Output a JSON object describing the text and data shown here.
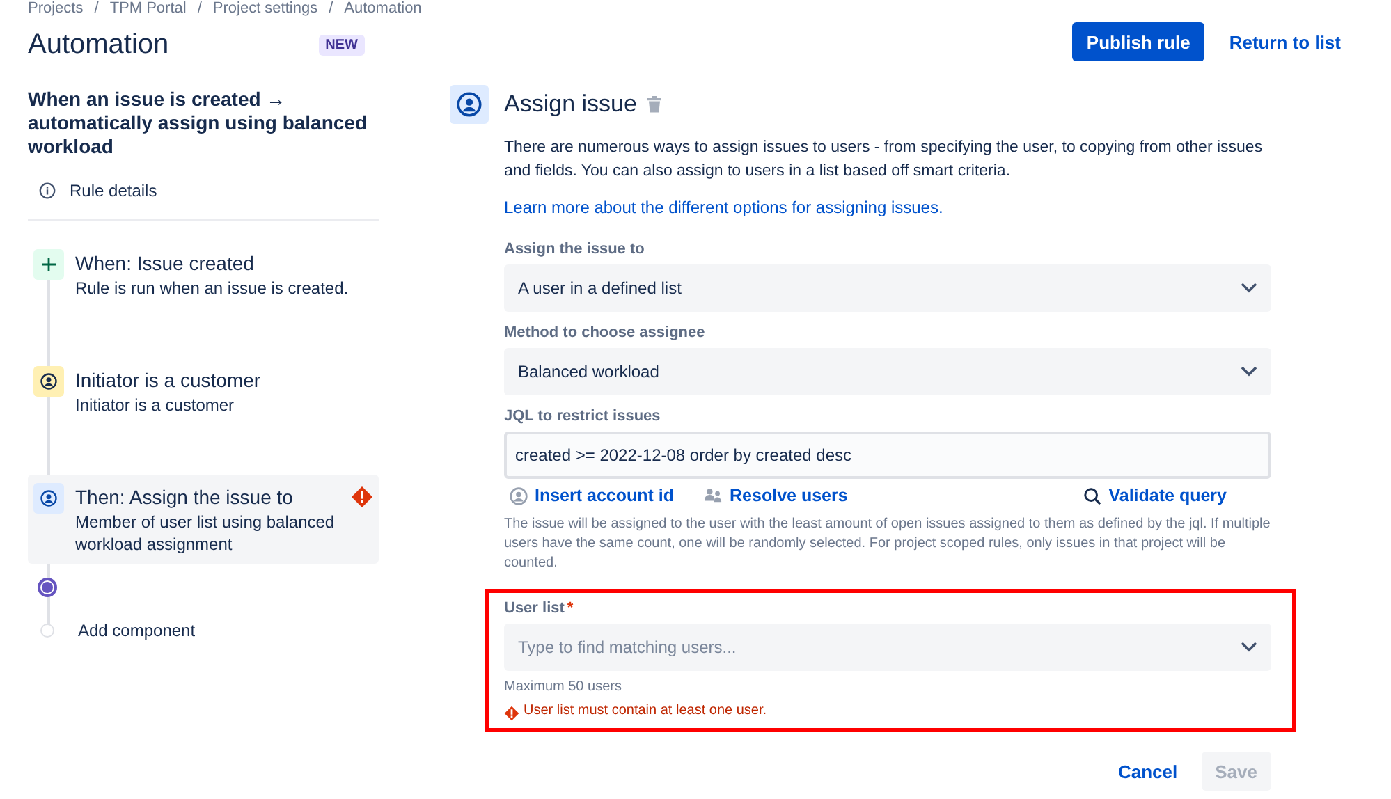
{
  "breadcrumbs": {
    "separator": "/",
    "items": [
      "Projects",
      "TPM Portal",
      "Project settings",
      "Automation"
    ]
  },
  "sidebar": {
    "title": "Automation",
    "badge": "NEW",
    "rule_name": "When an issue is created → automatically assign using balanced workload",
    "rule_details": "Rule details",
    "steps": [
      {
        "kind": "trigger",
        "title": "When: Issue created",
        "description": "Rule is run when an issue is created.",
        "selected": false,
        "error": false
      },
      {
        "kind": "condition",
        "title": "Initiator is a customer",
        "description": "Initiator is a customer",
        "selected": false,
        "error": false
      },
      {
        "kind": "action",
        "title": "Then: Assign the issue to",
        "description": "Member of user list using balanced workload assignment",
        "selected": true,
        "error": true
      }
    ],
    "add_component": "Add component"
  },
  "header_actions": {
    "publish": "Publish rule",
    "return": "Return to list"
  },
  "panel": {
    "title": "Assign issue",
    "description": "There are numerous ways to assign issues to users - from specifying the user, to copying from other issues and fields. You can also assign to users in a list based off smart criteria.",
    "learn_more": "Learn more about the different options for assigning issues.",
    "fields": [
      {
        "kind": "select",
        "label": "Assign the issue to",
        "value": "A user in a defined list"
      },
      {
        "kind": "select",
        "label": "Method to choose assignee",
        "value": "Balanced workload"
      },
      {
        "kind": "input",
        "label": "JQL to restrict issues",
        "value": "created >= 2022-12-08 order by created desc"
      }
    ],
    "jql_actions": [
      {
        "kind": "account",
        "label": "Insert account id"
      },
      {
        "kind": "users",
        "label": "Resolve users"
      },
      {
        "kind": "search",
        "label": "Validate query"
      }
    ],
    "help": "The issue will be assigned to the user with the least amount of open issues assigned to them as defined by the jql. If multiple users have the same count, one will be randomly selected. For project scoped rules, only issues in that project will be counted.",
    "user_list": {
      "label": "User list",
      "required_mark": "*",
      "placeholder": "Type to find matching users...",
      "hint": "Maximum 50 users",
      "error": "User list must contain at least one user.",
      "highlighted": true
    },
    "buttons": {
      "cancel": "Cancel",
      "save": "Save",
      "save_disabled": true
    }
  }
}
